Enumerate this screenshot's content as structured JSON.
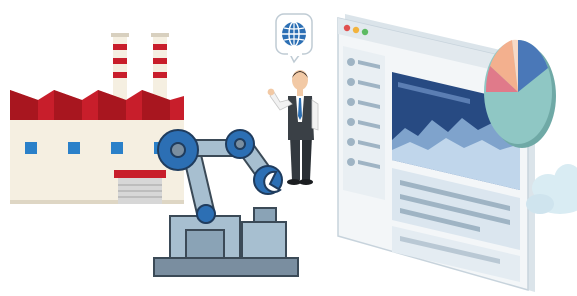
{
  "illustration": {
    "factory_building": {
      "icon": "factory-icon"
    },
    "robot_arm": {
      "icon": "robot-arm-icon"
    },
    "businessman": {
      "icon": "businessman-icon"
    },
    "speech_bubble": {
      "icon": "globe-icon"
    },
    "browser_dashboard": {
      "icon": "dashboard-browser-icon"
    },
    "pie_chart": {
      "icon": "pie-chart-icon"
    },
    "cloud": {
      "icon": "cloud-icon"
    }
  },
  "colors": {
    "factory_wall": "#f5efe1",
    "factory_roof": "#c81e2b",
    "chimney_stripe": "#c81e2b",
    "window_blue": "#2a80c9",
    "robot_blue": "#2c6fb4",
    "robot_gray": "#7a8ea0",
    "robot_steel": "#a7bfd0",
    "browser_frame": "#e8eef2",
    "browser_navy": "#274a82",
    "browser_panel": "#b8d1e8",
    "pie_red": "#e07a8a",
    "pie_salmon": "#f3b08e",
    "pie_teal": "#8fc7c4",
    "pie_blue": "#4a78b8",
    "cloud": "#d9ecf3"
  }
}
